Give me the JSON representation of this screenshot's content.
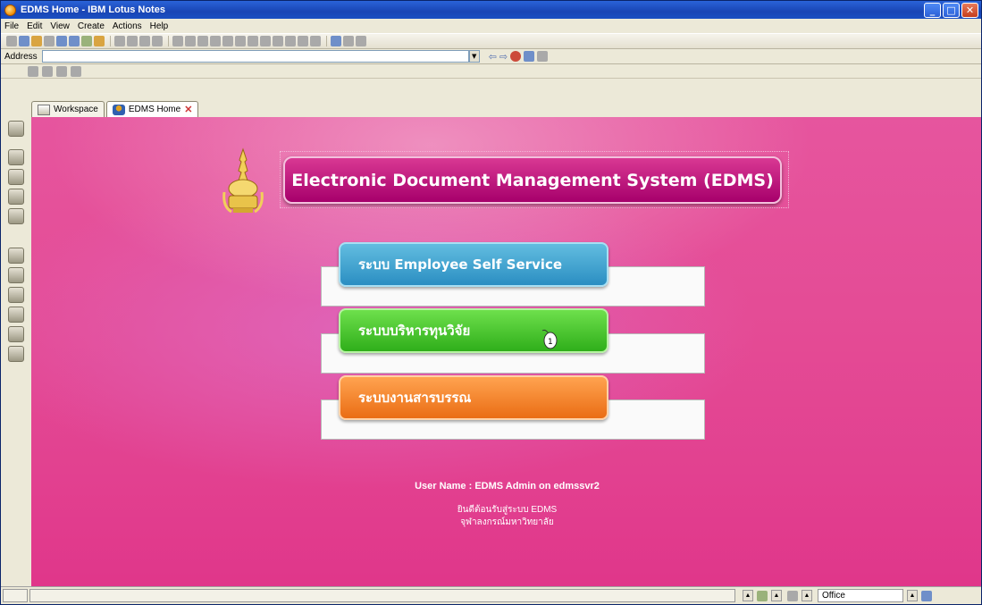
{
  "window": {
    "title": "EDMS Home - IBM Lotus Notes",
    "controls": [
      "_",
      "□",
      "✕"
    ]
  },
  "menu": [
    "File",
    "Edit",
    "View",
    "Create",
    "Actions",
    "Help"
  ],
  "address": {
    "label": "Address",
    "value": ""
  },
  "tabs": [
    {
      "label": "Workspace",
      "icon": "workspace-icon"
    },
    {
      "label": "EDMS Home",
      "icon": "home-person-icon",
      "close": "✕"
    }
  ],
  "content": {
    "title": "Electronic Document Management System (EDMS)",
    "buttons": [
      {
        "label": "ระบบ Employee Self Service",
        "color": "#2b8ec2"
      },
      {
        "label": "ระบบบริหารทุนวิจัย",
        "color": "#2fae1a"
      },
      {
        "label": "ระบบงานสารบรรณ",
        "color": "#ea6d14"
      }
    ],
    "user_line": "User Name : EDMS Admin on edmssvr2",
    "welcome": "ยินดีต้อนรับสู่ระบบ EDMS",
    "university": "จุฬาลงกรณ์มหาวิทยาลัย"
  },
  "statusbar": {
    "location": "Office"
  }
}
